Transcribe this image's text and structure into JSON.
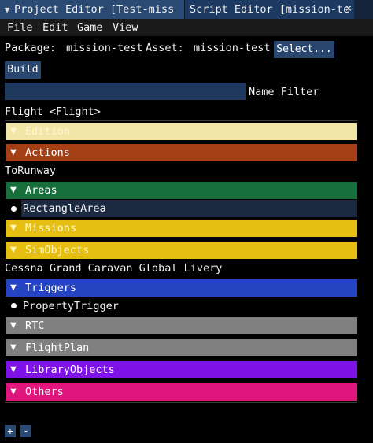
{
  "tabs": [
    {
      "label": "Project Editor [Test-miss"
    },
    {
      "label": "Script Editor [mission-te"
    }
  ],
  "tab_close": "×",
  "menu": [
    "File",
    "Edit",
    "Game",
    "View"
  ],
  "package": {
    "label": "Package:",
    "value": "mission-test"
  },
  "asset": {
    "label": "Asset:",
    "value": "mission-test"
  },
  "select_button": "Select...",
  "build_button": "Build",
  "name_filter": {
    "label": "Name Filter",
    "value": ""
  },
  "flight_label": "Flight <Flight>",
  "sections": {
    "edition": {
      "label": "Edition",
      "color": "#f2e6a6"
    },
    "actions": {
      "label": "Actions",
      "color": "#a53f16"
    },
    "areas": {
      "label": "Areas",
      "color": "#17703c"
    },
    "missions": {
      "label": "Missions",
      "color": "#e7bf12"
    },
    "simobjects": {
      "label": "SimObjects",
      "color": "#e7bf12"
    },
    "triggers": {
      "label": "Triggers",
      "color": "#2444c4"
    },
    "rtc": {
      "label": "RTC",
      "color": "#808080"
    },
    "flightplan": {
      "label": "FlightPlan",
      "color": "#808080"
    },
    "libraryobjects": {
      "label": "LibraryObjects",
      "color": "#7f12e6"
    },
    "others": {
      "label": "Others",
      "color": "#e0167c"
    }
  },
  "items": {
    "to_runway": "ToRunway",
    "rectangle_area": "RectangleArea",
    "cessna": "Cessna Grand Caravan Global Livery",
    "property_trigger": "PropertyTrigger"
  },
  "add_button": "+",
  "remove_button": "-"
}
